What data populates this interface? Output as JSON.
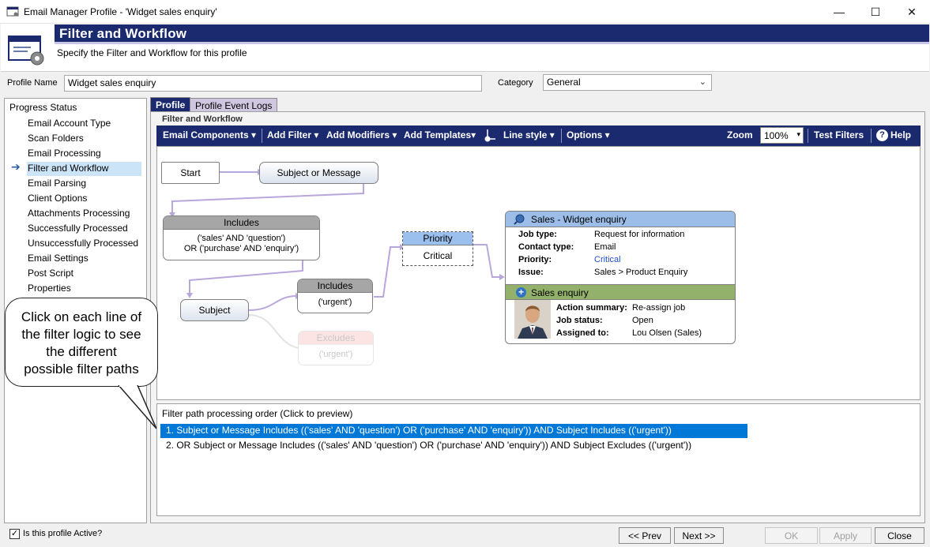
{
  "window": {
    "title": "Email Manager Profile - 'Widget sales enquiry'",
    "controls": {
      "minimize": "—",
      "maximize": "☐",
      "close": "✕"
    }
  },
  "banner": {
    "heading": "Filter and Workflow",
    "subheading": "Specify the Filter and Workflow for this profile"
  },
  "profile": {
    "name_label": "Profile Name",
    "name_value": "Widget sales enquiry",
    "category_label": "Category",
    "category_value": "General"
  },
  "progress": {
    "title": "Progress Status",
    "steps": [
      "Email Account Type",
      "Scan Folders",
      "Email Processing",
      "Filter and Workflow",
      "Email Parsing",
      "Client Options",
      "Attachments Processing",
      "Successfully Processed",
      "Unsuccessfully Processed",
      "Email Settings",
      "Post Script",
      "Properties"
    ],
    "active_index": 3
  },
  "tabs": {
    "profile": "Profile",
    "logs": "Profile Event Logs"
  },
  "section_title": "Filter and Workflow",
  "toolbar": {
    "email_components": "Email Components",
    "add_filter": "Add Filter",
    "add_modifiers": "Add Modifiers",
    "add_templates": "Add Templates",
    "line_style": "Line style",
    "options": "Options",
    "zoom_label": "Zoom",
    "zoom_value": "100%",
    "test_filters": "Test Filters",
    "help": "Help"
  },
  "diagram": {
    "start": "Start",
    "subject_or_message": "Subject or Message",
    "includes1_header": "Includes",
    "includes1_line1": "('sales' AND 'question')",
    "includes1_line2": "OR ('purchase' AND 'enquiry')",
    "subject": "Subject",
    "includes2_header": "Includes",
    "includes2_body": "('urgent')",
    "excludes_header": "Excludes",
    "excludes_body": "('urgent')",
    "priority_header": "Priority",
    "priority_body": "Critical",
    "job_title": "Sales - Widget enquiry",
    "job_fields": [
      {
        "label": "Job type:",
        "value": "Request for information"
      },
      {
        "label": "Contact type:",
        "value": "Email"
      },
      {
        "label": "Priority:",
        "value": "Critical"
      },
      {
        "label": "Issue:",
        "value": "Sales > Product Enquiry"
      }
    ],
    "action_title": "Sales enquiry",
    "action_fields": [
      {
        "label": "Action summary:",
        "value": "Re-assign job"
      },
      {
        "label": "Job status:",
        "value": "Open"
      },
      {
        "label": "Assigned to:",
        "value": "Lou Olsen (Sales)"
      }
    ],
    "colors": {
      "connector": "#b9a6dc",
      "job_header": "#9bbde8",
      "action_header": "#93b16a",
      "priority_header": "#9cc0ee"
    }
  },
  "callout": {
    "line1": "Click on each line of",
    "line2": "the filter logic to see",
    "line3": "the different",
    "line4": "possible filter paths"
  },
  "order": {
    "title": "Filter path processing order (Click to preview)",
    "items": [
      "1. Subject or Message Includes (('sales' AND 'question') OR ('purchase' AND 'enquiry')) AND Subject Includes (('urgent'))",
      "2. OR Subject or Message Includes (('sales' AND 'question') OR ('purchase' AND 'enquiry')) AND Subject Excludes (('urgent'))"
    ]
  },
  "footer": {
    "active_label": "Is this profile Active?",
    "active_checked": true,
    "prev": "<< Prev",
    "next": "Next >>",
    "ok": "OK",
    "apply": "Apply",
    "close": "Close"
  }
}
